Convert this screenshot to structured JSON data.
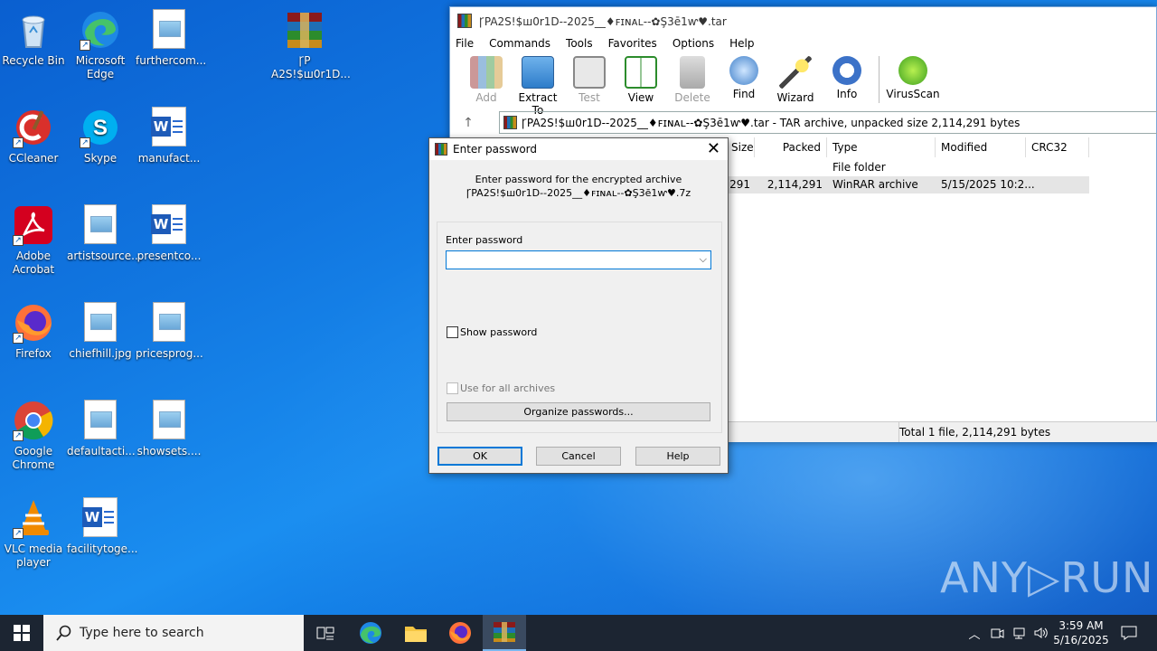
{
  "desktop": {
    "icons": [
      {
        "label": "Recycle Bin",
        "kind": "recycle"
      },
      {
        "label": "Microsoft Edge",
        "kind": "edge"
      },
      {
        "label": "furthercom...",
        "kind": "file"
      },
      {
        "label": "ꞄP A2S!$ш0r1D...",
        "kind": "rar"
      },
      {
        "label": "CCleaner",
        "kind": "ccleaner"
      },
      {
        "label": "Skype",
        "kind": "skype"
      },
      {
        "label": "manufact...",
        "kind": "word"
      },
      {
        "label": "Adobe Acrobat",
        "kind": "acrobat"
      },
      {
        "label": "artistsource...",
        "kind": "file"
      },
      {
        "label": "presentco...",
        "kind": "word"
      },
      {
        "label": "Firefox",
        "kind": "firefox"
      },
      {
        "label": "chiefhill.jpg",
        "kind": "file"
      },
      {
        "label": "pricesprog...",
        "kind": "file"
      },
      {
        "label": "Google Chrome",
        "kind": "chrome"
      },
      {
        "label": "defaultacti...",
        "kind": "file"
      },
      {
        "label": "showsets....",
        "kind": "file"
      },
      {
        "label": "VLC media player",
        "kind": "vlc"
      },
      {
        "label": "facilitytoge...",
        "kind": "word"
      }
    ],
    "watermark": "ANY▷RUN"
  },
  "winrar": {
    "title": "ꞄPA2S!$ш0r1D--2025__♦ꜰɪɴᴀʟ--✿Ş3ē1ⱳ♥.tar",
    "menu": [
      "File",
      "Commands",
      "Tools",
      "Favorites",
      "Options",
      "Help"
    ],
    "toolbar": [
      {
        "label": "Add",
        "icon": "add-icon",
        "enabled": false
      },
      {
        "label": "Extract To",
        "icon": "extract-icon",
        "enabled": true
      },
      {
        "label": "Test",
        "icon": "test-icon",
        "enabled": false
      },
      {
        "label": "View",
        "icon": "view-icon",
        "enabled": true
      },
      {
        "label": "Delete",
        "icon": "delete-icon",
        "enabled": false
      },
      {
        "label": "Find",
        "icon": "find-icon",
        "enabled": true
      },
      {
        "label": "Wizard",
        "icon": "wizard-icon",
        "enabled": true
      },
      {
        "label": "Info",
        "icon": "info-icon",
        "enabled": true
      },
      {
        "label": "VirusScan",
        "icon": "virusscan-icon",
        "enabled": true
      }
    ],
    "address": "ꞄPA2S!$ш0r1D--2025__♦ꜰɪɴᴀʟ--✿Ş3ē1ⱳ♥.tar - TAR archive, unpacked size 2,114,291 bytes",
    "columns": [
      "Size",
      "Packed",
      "Type",
      "Modified",
      "CRC32"
    ],
    "rows": [
      {
        "size": "",
        "packed": "",
        "type": "File folder",
        "modified": "",
        "crc": ""
      },
      {
        "size": "2,114,291",
        "packed": "2,114,291",
        "type": "WinRAR archive",
        "modified": "5/15/2025 10:2...",
        "crc": ""
      }
    ],
    "status": "Total 1 file, 2,114,291 bytes"
  },
  "dialog": {
    "title": "Enter password",
    "info_line1": "Enter password for the encrypted archive",
    "info_line2": "ꞄPA2S!$ш0r1D--2025__♦ꜰɪɴᴀʟ--✿Ş3ē1ⱳ♥.7z",
    "field_label": "Enter password",
    "password_value": "",
    "show_password": "Show password",
    "use_all": "Use for all archives",
    "organize": "Organize passwords...",
    "ok": "OK",
    "cancel": "Cancel",
    "help": "Help"
  },
  "taskbar": {
    "search_placeholder": "Type here to search",
    "time": "3:59 AM",
    "date": "5/16/2025"
  },
  "colors": {
    "accent": "#0078d7",
    "taskbar": "#1c2532"
  }
}
